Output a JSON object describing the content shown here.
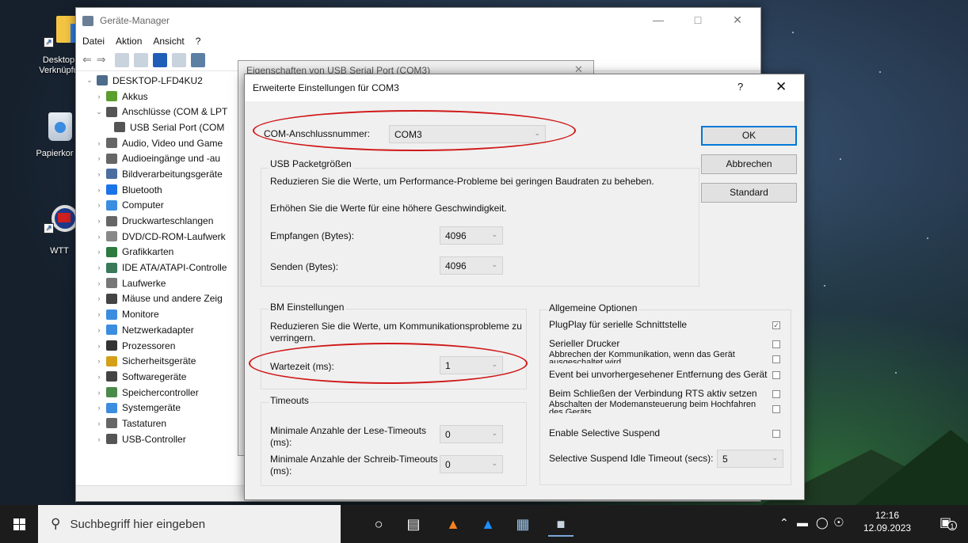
{
  "desktop": {
    "icons": [
      {
        "label": "Desktop Verknüpfu",
        "icon": "folder-shortcut-icon"
      },
      {
        "label": "Papierkor",
        "icon": "recycle-bin-icon"
      },
      {
        "label": "WTT",
        "icon": "wtt-app-icon"
      }
    ]
  },
  "devmgr": {
    "title": "Geräte-Manager",
    "menu": [
      "Datei",
      "Aktion",
      "Ansicht",
      "?"
    ],
    "root": "DESKTOP-LFD4KU2",
    "tree": [
      {
        "label": "Akkus",
        "expanded": false,
        "color": "#5a9e2f"
      },
      {
        "label": "Anschlüsse (COM & LPT",
        "expanded": true,
        "color": "#555555"
      },
      {
        "label": "USB Serial Port (COM",
        "child": true,
        "color": "#555555"
      },
      {
        "label": "Audio, Video und Game",
        "expanded": false,
        "color": "#666666"
      },
      {
        "label": "Audioeingänge und -au",
        "expanded": false,
        "color": "#666666"
      },
      {
        "label": "Bildverarbeitungsgeräte",
        "expanded": false,
        "color": "#4a6ea0"
      },
      {
        "label": "Bluetooth",
        "expanded": false,
        "color": "#1a73e8"
      },
      {
        "label": "Computer",
        "expanded": false,
        "color": "#3b8de0"
      },
      {
        "label": "Druckwarteschlangen",
        "expanded": false,
        "color": "#666666"
      },
      {
        "label": "DVD/CD-ROM-Laufwerk",
        "expanded": false,
        "color": "#888888"
      },
      {
        "label": "Grafikkarten",
        "expanded": false,
        "color": "#2f7a3f"
      },
      {
        "label": "IDE ATA/ATAPI-Controlle",
        "expanded": false,
        "color": "#3a7a5a"
      },
      {
        "label": "Laufwerke",
        "expanded": false,
        "color": "#777777"
      },
      {
        "label": "Mäuse und andere Zeig",
        "expanded": false,
        "color": "#444444"
      },
      {
        "label": "Monitore",
        "expanded": false,
        "color": "#3b8de0"
      },
      {
        "label": "Netzwerkadapter",
        "expanded": false,
        "color": "#3b8de0"
      },
      {
        "label": "Prozessoren",
        "expanded": false,
        "color": "#333333"
      },
      {
        "label": "Sicherheitsgeräte",
        "expanded": false,
        "color": "#d4a017"
      },
      {
        "label": "Softwaregeräte",
        "expanded": false,
        "color": "#444444"
      },
      {
        "label": "Speichercontroller",
        "expanded": false,
        "color": "#4a8a4a"
      },
      {
        "label": "Systemgeräte",
        "expanded": false,
        "color": "#3b8de0"
      },
      {
        "label": "Tastaturen",
        "expanded": false,
        "color": "#666666"
      },
      {
        "label": "USB-Controller",
        "expanded": false,
        "color": "#555555"
      }
    ]
  },
  "props": {
    "title": "Eigenschaften von USB Serial Port (COM3)"
  },
  "dialog": {
    "title": "Erweiterte Einstellungen für COM3",
    "help": "?",
    "close": "✕",
    "com_label": "COM-Anschlussnummer:",
    "com_value": "COM3",
    "usb_group": "USB Packetgrößen",
    "usb_desc1": "Reduzieren Sie die Werte, um Performance-Probleme bei geringen Baudraten zu beheben.",
    "usb_desc2": "Erhöhen Sie die Werte für eine höhere Geschwindigkeit.",
    "receive_label": "Empfangen (Bytes):",
    "receive_value": "4096",
    "send_label": "Senden (Bytes):",
    "send_value": "4096",
    "bm_group": "BM Einstellungen",
    "bm_desc": "Reduzieren Sie die Werte, um Kommunikationsprobleme zu verringern.",
    "latency_label": "Wartezeit (ms):",
    "latency_value": "1",
    "timeouts_group": "Timeouts",
    "read_timeout_label": "Minimale Anzahle der Lese-Timeouts (ms):",
    "read_timeout_value": "0",
    "write_timeout_label": "Minimale Anzahle der Schreib-Timeouts (ms):",
    "write_timeout_value": "0",
    "general_group": "Allgemeine Optionen",
    "options": [
      {
        "label": "PlugPlay für serielle Schnittstelle",
        "checked": true
      },
      {
        "label": "Serieller Drucker",
        "checked": false
      },
      {
        "label": "Abbrechen der Kommunikation, wenn das Gerät ausgeschaltet wird",
        "checked": false
      },
      {
        "label": "Event bei unvorhergesehener Entfernung des Geräts",
        "checked": false
      },
      {
        "label": "Beim Schließen der Verbindung RTS aktiv setzen",
        "checked": false
      },
      {
        "label": "Abschalten der Modemansteuerung beim Hochfahren des Geräts",
        "checked": false
      },
      {
        "label": "Enable Selective Suspend",
        "checked": false
      }
    ],
    "idle_label": "Selective Suspend Idle Timeout (secs):",
    "idle_value": "5",
    "ok": "OK",
    "cancel": "Abbrechen",
    "defaults": "Standard",
    "checkmark": "☑"
  },
  "taskbar": {
    "search_placeholder": "Suchbegriff hier eingeben",
    "time": "12:16",
    "date": "12.09.2023",
    "notifications": "1"
  }
}
